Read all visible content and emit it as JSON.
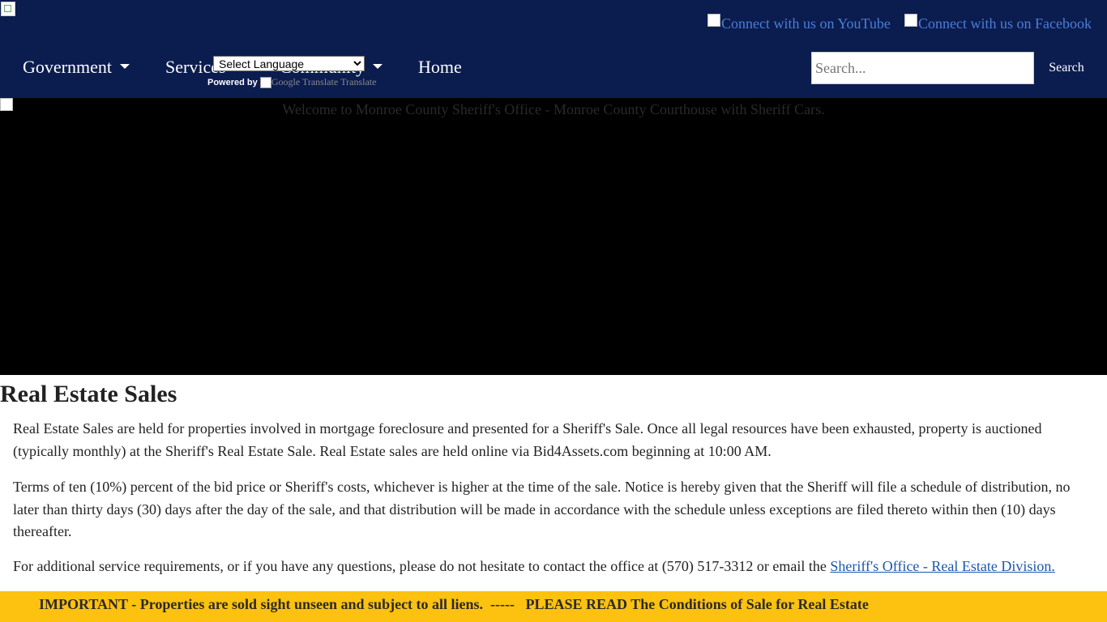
{
  "header": {
    "social": {
      "youtube_alt": "Connect with us on YouTube",
      "facebook_alt": "Connect with us on Facebook"
    },
    "nav": {
      "government": "Government",
      "services": "Services",
      "community": "Community",
      "home": "Home"
    },
    "translate": {
      "select_value": "Select Language",
      "powered_by": "Powered by",
      "google_alt": "Google Translate",
      "translate_label": "Translate"
    },
    "search": {
      "placeholder": "Search...",
      "button_label": "Search"
    },
    "background_color": "#0b1c4f"
  },
  "banner": {
    "alt_text": "Welcome to Monroe County Sheriff's Office - Monroe County Courthouse with Sheriff Cars."
  },
  "main": {
    "title": "Real Estate Sales",
    "paragraph1": "Real Estate Sales are held for properties involved in mortgage foreclosure and presented for a Sheriff's Sale. Once all legal resources have been exhausted, property is auctioned (typically monthly) at the Sheriff's Real Estate Sale. Real Estate sales are held online via Bid4Assets.com beginning at 10:00 AM.",
    "paragraph2": "Terms of ten (10%) percent of the bid price or Sheriff's costs, whichever is higher at the time of the sale. Notice is hereby given that the Sheriff will file a schedule of distribution, no later than thirty days (30) days after the day of the sale, and that distribution will be made in accordance with the schedule unless exceptions are filed thereto within then (10) days thereafter.",
    "paragraph3_text": "For additional service requirements, or if you have any questions, please do not hesitate to contact the office at (570) 517-3312 or email the ",
    "paragraph3_link": "Sheriff's Office - Real Estate Division."
  },
  "notice": {
    "text": "IMPORTANT - Properties are sold sight unseen and subject to all liens.  -----   PLEASE READ The Conditions of Sale for Real Estate",
    "background_color": "#fdc10f"
  }
}
